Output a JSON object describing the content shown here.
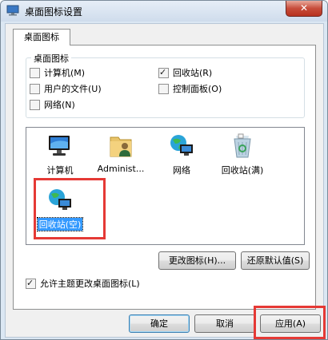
{
  "window": {
    "title": "桌面图标设置",
    "close_label": "✕",
    "icon": "desktop-icon"
  },
  "tab": {
    "label": "桌面图标"
  },
  "group": {
    "label": "桌面图标",
    "checkboxes": [
      {
        "label": "计算机(M)",
        "checked": false
      },
      {
        "label": "回收站(R)",
        "checked": true
      },
      {
        "label": "用户的文件(U)",
        "checked": false
      },
      {
        "label": "控制面板(O)",
        "checked": false
      },
      {
        "label": "网络(N)",
        "checked": false
      }
    ]
  },
  "icons": [
    {
      "label": "计算机",
      "icon": "computer-icon"
    },
    {
      "label": "Administ...",
      "icon": "user-folder-icon"
    },
    {
      "label": "网络",
      "icon": "network-icon"
    },
    {
      "label": "回收站(满)",
      "icon": "recycle-bin-full-icon"
    },
    {
      "label": "回收站(空)",
      "icon": "recycle-bin-empty-icon",
      "selected": true
    }
  ],
  "buttons": {
    "change_icon": "更改图标(H)...",
    "restore_default": "还原默认值(S)"
  },
  "theme_checkbox": {
    "label": "允许主题更改桌面图标(L)",
    "checked": true
  },
  "footer": {
    "ok": "确定",
    "cancel": "取消",
    "apply": "应用(A)"
  },
  "colors": {
    "highlight": "#e53935",
    "selection": "#3399ff"
  }
}
